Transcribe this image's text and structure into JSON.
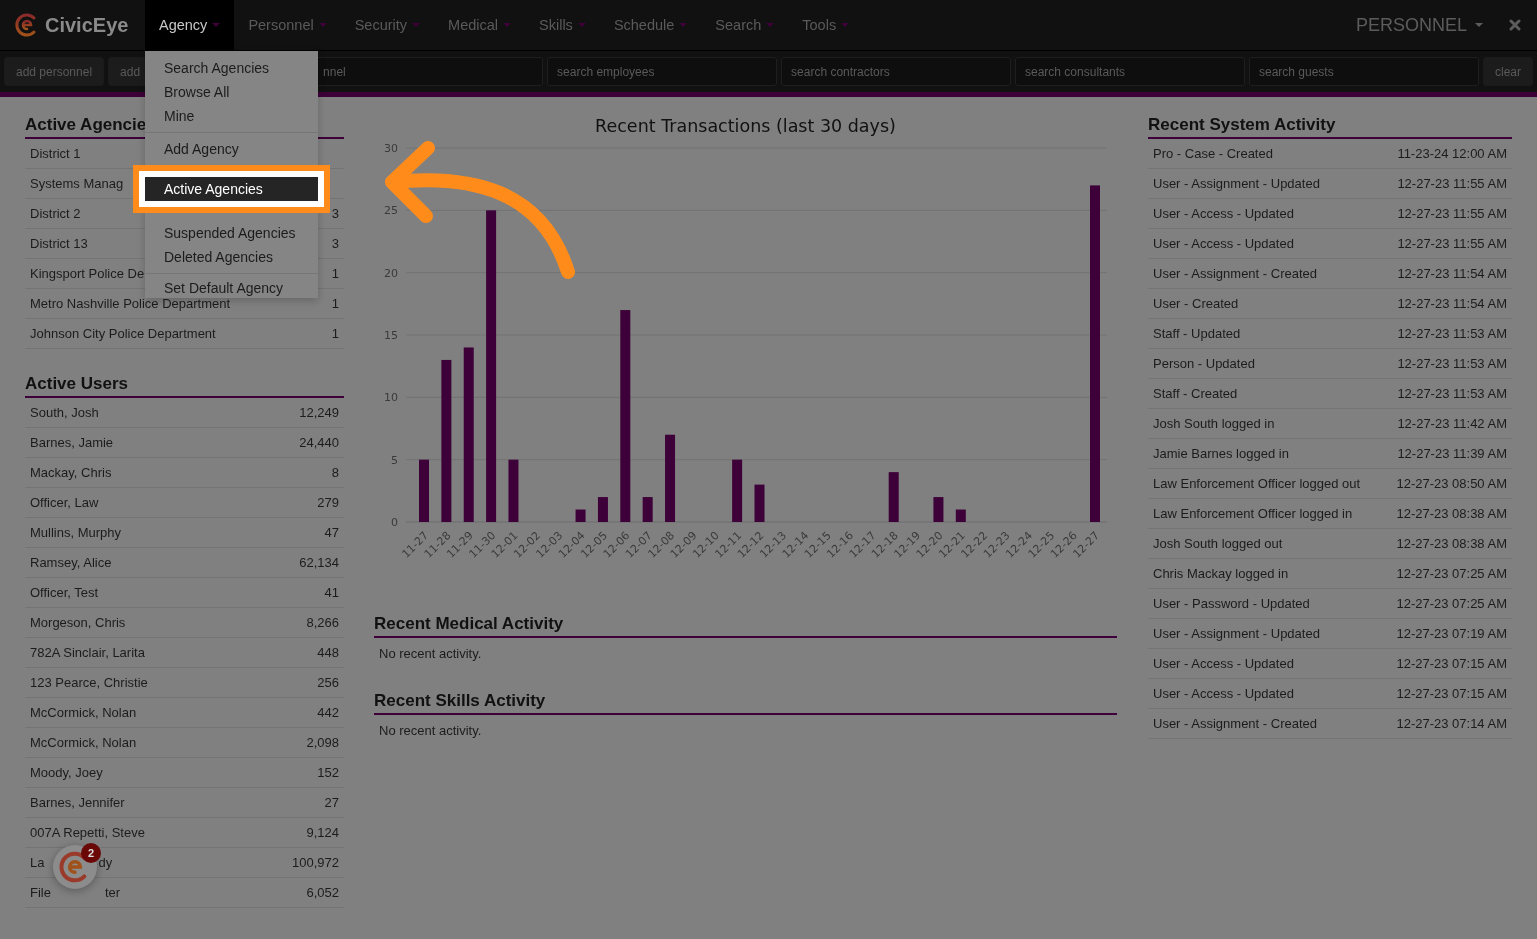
{
  "brand": {
    "name": "CivicEye"
  },
  "nav": [
    {
      "label": "Agency",
      "selected": true
    },
    {
      "label": "Personnel",
      "selected": false
    },
    {
      "label": "Security",
      "selected": false
    },
    {
      "label": "Medical",
      "selected": false
    },
    {
      "label": "Skills",
      "selected": false
    },
    {
      "label": "Schedule",
      "selected": false
    },
    {
      "label": "Search",
      "selected": false
    },
    {
      "label": "Tools",
      "selected": false
    }
  ],
  "account": {
    "label": "PERSONNEL"
  },
  "toolbar": {
    "buttons": [
      "add personnel",
      "add"
    ],
    "fields": [
      {
        "placeholder": "nnel"
      },
      {
        "placeholder": "search employees"
      },
      {
        "placeholder": "search contractors"
      },
      {
        "placeholder": "search consultants"
      },
      {
        "placeholder": "search guests"
      }
    ],
    "clear": "clear"
  },
  "agency_menu": {
    "groups": [
      [
        {
          "label": "Search Agencies",
          "selected": false
        },
        {
          "label": "Browse All",
          "selected": false
        },
        {
          "label": "Mine",
          "selected": false
        }
      ],
      [
        {
          "label": "Add Agency",
          "selected": false
        },
        {
          "label": "Active Agencies",
          "selected": true
        },
        {
          "label": "Suspended Agencies",
          "selected": false
        },
        {
          "label": "Deleted Agencies",
          "selected": false
        }
      ],
      [
        {
          "label": "Set Default Agency",
          "selected": false
        }
      ]
    ]
  },
  "active_agencies": {
    "title": "Active Agencie",
    "rows": [
      {
        "name": "District 1",
        "count": ""
      },
      {
        "name": "Systems Manag",
        "count": ""
      },
      {
        "name": "District 2",
        "count": "3"
      },
      {
        "name": "District 13",
        "count": "3"
      },
      {
        "name": "Kingsport Police De",
        "count": "1"
      },
      {
        "name": "Metro Nashville Police Department",
        "count": "1"
      },
      {
        "name": "Johnson City Police Department",
        "count": "1"
      }
    ]
  },
  "active_users": {
    "title": "Active Users",
    "rows": [
      {
        "name": [
          "South, Josh"
        ],
        "count": "12,249"
      },
      {
        "name": [
          "Barnes, Jamie"
        ],
        "count": "24,440"
      },
      {
        "name": [
          "Mackay, Chris"
        ],
        "count": "8"
      },
      {
        "name": [
          "Officer, Law"
        ],
        "count": "279"
      },
      {
        "name": [
          "Mullins, Murphy"
        ],
        "count": "47"
      },
      {
        "name": [
          "Ramsey, Alice"
        ],
        "count": "62,134"
      },
      {
        "name": [
          "Officer, Test"
        ],
        "count": "41"
      },
      {
        "name": [
          "Morgeson, Chris"
        ],
        "count": "8,266"
      },
      {
        "name": [
          "782A Sinclair, Larita"
        ],
        "count": "448"
      },
      {
        "name": [
          "123 Pearce, Christie"
        ],
        "count": "256"
      },
      {
        "name": [
          "McCormick, Nolan"
        ],
        "count": "442"
      },
      {
        "name": [
          "McCormick, Nolan"
        ],
        "count": "2,098"
      },
      {
        "name": [
          "Moody, Joey"
        ],
        "count": "152"
      },
      {
        "name": [
          "Barnes, Jennifer"
        ],
        "count": "27"
      },
      {
        "name": [
          "007A Repetti, Steve"
        ],
        "count": "9,124"
      },
      {
        "name": [
          "La",
          "dy"
        ],
        "count": "100,972"
      },
      {
        "name": [
          "File",
          "ter"
        ],
        "count": "6,052"
      }
    ]
  },
  "transactions": {
    "chart_data": {
      "type": "bar",
      "title": "Recent Transactions (last 30 days)",
      "categories": [
        "11-27",
        "11-28",
        "11-29",
        "11-30",
        "12-01",
        "12-02",
        "12-03",
        "12-04",
        "12-05",
        "12-06",
        "12-07",
        "12-08",
        "12-09",
        "12-10",
        "12-11",
        "12-12",
        "12-13",
        "12-14",
        "12-15",
        "12-16",
        "12-17",
        "12-18",
        "12-19",
        "12-20",
        "12-21",
        "12-22",
        "12-23",
        "12-24",
        "12-25",
        "12-26",
        "12-27"
      ],
      "values": [
        5,
        13,
        14,
        25,
        5,
        0,
        0,
        1,
        2,
        17,
        2,
        7,
        0,
        0,
        5,
        3,
        0,
        0,
        0,
        0,
        0,
        4,
        0,
        2,
        1,
        0,
        0,
        0,
        0,
        0,
        27
      ],
      "ylim": [
        0,
        30
      ],
      "yticks": [
        0,
        5,
        10,
        15,
        20,
        25,
        30
      ],
      "grid": true
    }
  },
  "medical": {
    "title": "Recent Medical Activity",
    "empty": "No recent activity."
  },
  "skills": {
    "title": "Recent Skills Activity",
    "empty": "No recent activity."
  },
  "system_activity": {
    "title": "Recent System Activity",
    "rows": [
      {
        "event": "Pro - Case - Created",
        "time": "11-23-24 12:00 AM"
      },
      {
        "event": "User - Assignment - Updated",
        "time": "12-27-23 11:55 AM"
      },
      {
        "event": "User - Access - Updated",
        "time": "12-27-23 11:55 AM"
      },
      {
        "event": "User - Access - Updated",
        "time": "12-27-23 11:55 AM"
      },
      {
        "event": "User - Assignment - Created",
        "time": "12-27-23 11:54 AM"
      },
      {
        "event": "User - Created",
        "time": "12-27-23 11:54 AM"
      },
      {
        "event": "Staff - Updated",
        "time": "12-27-23 11:53 AM"
      },
      {
        "event": "Person - Updated",
        "time": "12-27-23 11:53 AM"
      },
      {
        "event": "Staff - Created",
        "time": "12-27-23 11:53 AM"
      },
      {
        "event": "Josh South logged in",
        "time": "12-27-23 11:42 AM"
      },
      {
        "event": "Jamie Barnes logged in",
        "time": "12-27-23 11:39 AM"
      },
      {
        "event": "Law Enforcement Officer logged out",
        "time": "12-27-23 08:50 AM"
      },
      {
        "event": "Law Enforcement Officer logged in",
        "time": "12-27-23 08:38 AM"
      },
      {
        "event": "Josh South logged out",
        "time": "12-27-23 08:38 AM"
      },
      {
        "event": "Chris Mackay logged in",
        "time": "12-27-23 07:25 AM"
      },
      {
        "event": "User - Password - Updated",
        "time": "12-27-23 07:25 AM"
      },
      {
        "event": "User - Assignment - Updated",
        "time": "12-27-23 07:19 AM"
      },
      {
        "event": "User - Access - Updated",
        "time": "12-27-23 07:15 AM"
      },
      {
        "event": "User - Access - Updated",
        "time": "12-27-23 07:15 AM"
      },
      {
        "event": "User - Assignment - Created",
        "time": "12-27-23 07:14 AM"
      }
    ]
  },
  "chat_widget": {
    "badge": "2"
  }
}
